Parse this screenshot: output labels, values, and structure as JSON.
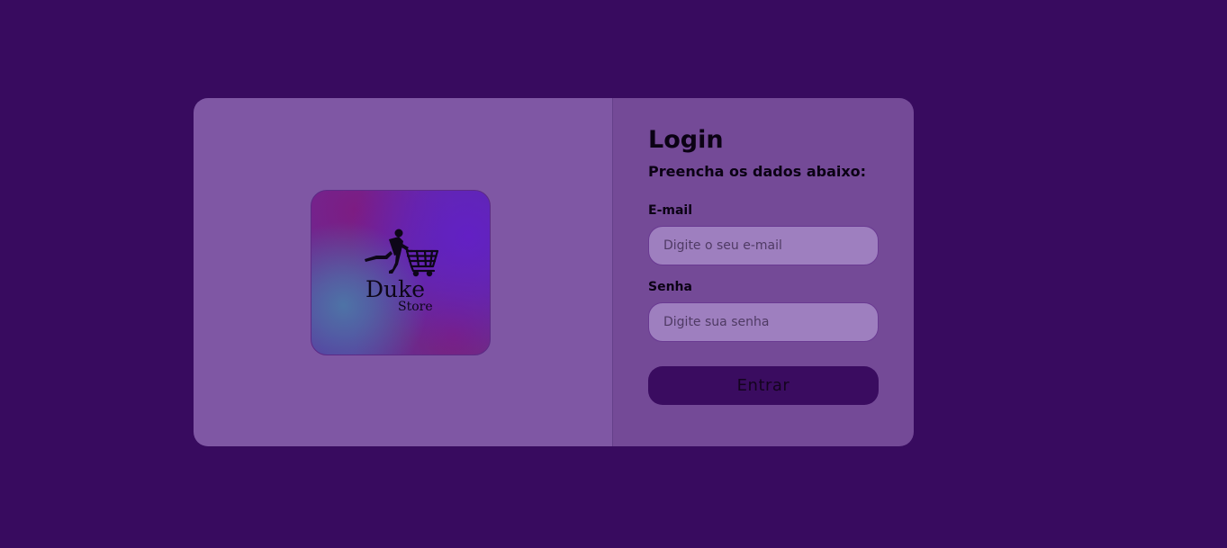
{
  "logo": {
    "brand_name": "Duke",
    "brand_sub": "Store",
    "icon": "shopper-with-cart-icon"
  },
  "login": {
    "title": "Login",
    "subtitle": "Preencha os dados abaixo:",
    "email_label": "E-mail",
    "email_placeholder": "Digite o seu e-mail",
    "email_value": "",
    "password_label": "Senha",
    "password_placeholder": "Digite sua senha",
    "password_value": "",
    "submit_label": "Entrar"
  },
  "colors": {
    "background": "#380b5f",
    "left_panel": "#7f57a4",
    "right_panel": "#744a97",
    "input_bg": "#9e7fbf",
    "button_bg": "#3a0c60"
  }
}
